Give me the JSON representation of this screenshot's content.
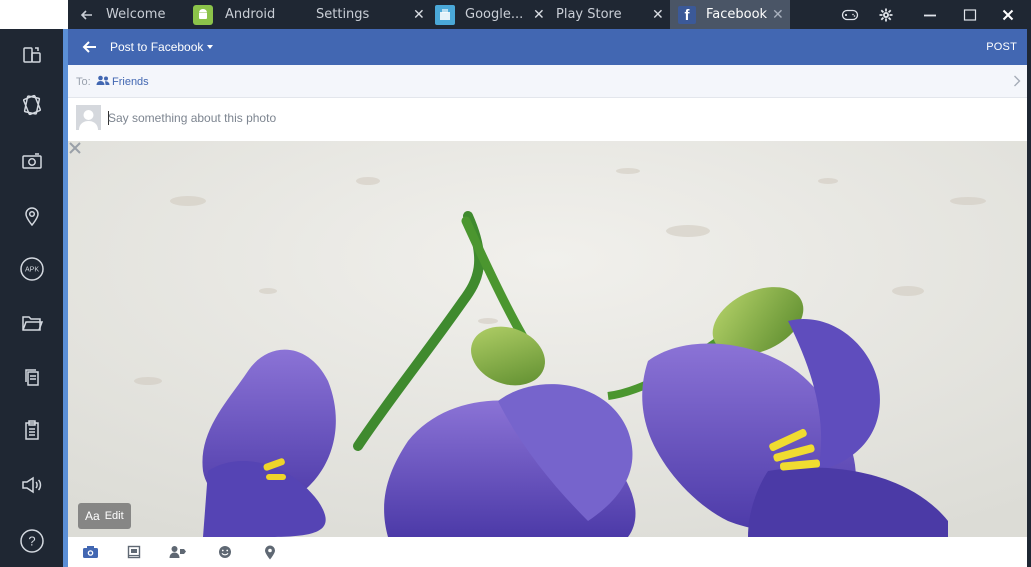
{
  "tabs": [
    {
      "label": "Welcome"
    },
    {
      "label": "Android"
    },
    {
      "label": "Settings"
    },
    {
      "label": "Google..."
    },
    {
      "label": "Play Store"
    },
    {
      "label": "Facebook"
    }
  ],
  "tab_close_glyph": "✕",
  "sidebar": {
    "items": [
      {
        "icon": "tablet-rotate-icon"
      },
      {
        "icon": "shake-icon"
      },
      {
        "icon": "camera-icon"
      },
      {
        "icon": "location-icon"
      },
      {
        "icon": "apk-icon",
        "label": "APK"
      },
      {
        "icon": "folder-icon"
      },
      {
        "icon": "copy-icon"
      },
      {
        "icon": "paste-icon"
      },
      {
        "icon": "volume-icon"
      },
      {
        "icon": "help-icon",
        "label": "?"
      }
    ]
  },
  "header": {
    "title": "Post to Facebook",
    "post_label": "POST"
  },
  "audience": {
    "to_label": "To:",
    "value": "Friends"
  },
  "composer": {
    "placeholder": "Say something about this photo"
  },
  "photo_overlay": {
    "aa_label": "Aa",
    "edit_label": "Edit"
  },
  "colors": {
    "facebook_blue": "#4267b2",
    "chrome_dark": "#1f2733",
    "sidebar_accent": "#5b8fd6"
  }
}
